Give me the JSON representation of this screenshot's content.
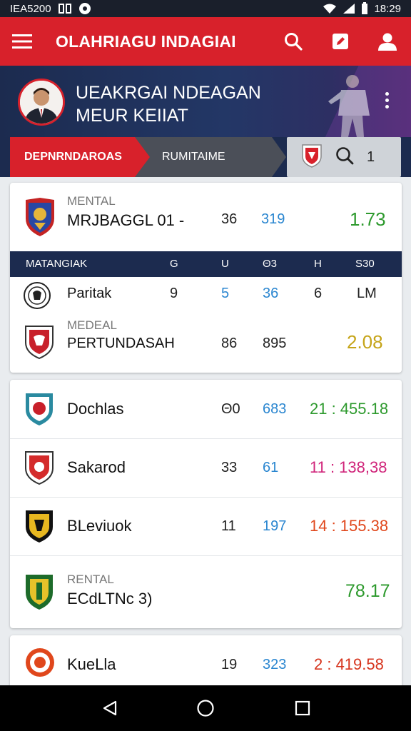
{
  "status_bar": {
    "left_text": "IEA5200",
    "time": "18:29"
  },
  "app_bar": {
    "title": "OLAHRIAGU INDAGIAI"
  },
  "profile": {
    "name_line1": "UEAKRGAI NDEAGAN",
    "name_line2": "MEUR KEIIAT"
  },
  "tabs": {
    "primary": "DEPNRNDAROAS",
    "secondary": "RUMITAIME",
    "count": "1"
  },
  "card1": {
    "top_row": {
      "label": "MENTAL",
      "team": "MRJBAGGL 01 -",
      "v1": "36",
      "v2": "319",
      "score": "1.73"
    },
    "table_head": {
      "c0": "MATANGIAK",
      "c1": "G",
      "c2": "U",
      "c3": "Θ3",
      "c4": "H",
      "c5": "S30"
    },
    "row2": {
      "team": "Paritak",
      "v1": "9",
      "v2": "5",
      "v3": "36",
      "v4": "6",
      "v5": "LM"
    },
    "row3": {
      "label": "MEDEAL",
      "team": "PERTUNDASAH",
      "v1": "86",
      "v2": "895",
      "score": "2.08"
    }
  },
  "card2": {
    "rows": [
      {
        "team": "Dochlas",
        "v1": "Θ0",
        "v2": "683",
        "score": "21 : 455.18",
        "score_color": "#2e9a2e"
      },
      {
        "team": "Sakarod",
        "v1": "33",
        "v2": "61",
        "score": "11 : 138,38",
        "score_color": "#d0247a"
      },
      {
        "team": "BLeviuok",
        "v1": "11",
        "v2": "197",
        "score": "14 : 155.38",
        "score_color": "#e0471c"
      },
      {
        "label": "RENTAL",
        "team": "ECdLTNc 3)",
        "score": "78.17",
        "score_color": "#2e9a2e"
      }
    ]
  },
  "card3": {
    "team": "KueLla",
    "v1": "19",
    "v2": "323",
    "score": "2 : 419.58",
    "score_color": "#d6331c"
  },
  "colors": {
    "brand_red": "#d8212b",
    "navy": "#1c2b4f",
    "green": "#2e9a2e",
    "gold": "#c5a418",
    "blue": "#2a86d0"
  },
  "icons": [
    "hamburger-menu-icon",
    "search-icon",
    "edit-icon",
    "user-icon",
    "more-vert-icon",
    "search-icon",
    "back-icon",
    "home-icon",
    "recents-icon"
  ]
}
